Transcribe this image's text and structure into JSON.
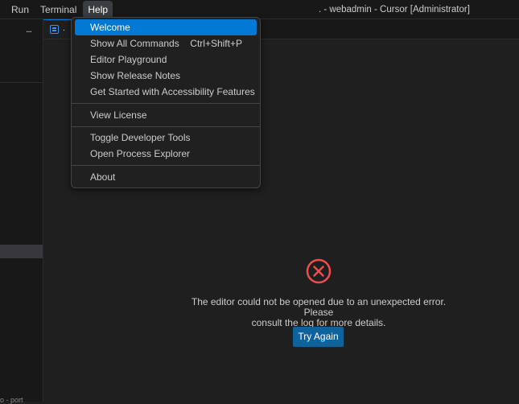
{
  "menubar": {
    "items": [
      "Run",
      "Terminal",
      "Help"
    ],
    "active": "Help"
  },
  "window_title": ". - webadmin - Cursor [Administrator]",
  "sidebar": {
    "more_label": "...",
    "status_text": "o - port"
  },
  "tab": {
    "label": "."
  },
  "help_menu": {
    "items": [
      {
        "label": "Welcome",
        "shortcut": ""
      },
      {
        "label": "Show All Commands",
        "shortcut": "Ctrl+Shift+P"
      },
      {
        "label": "Editor Playground",
        "shortcut": ""
      },
      {
        "label": "Show Release Notes",
        "shortcut": ""
      },
      {
        "label": "Get Started with Accessibility Features",
        "shortcut": ""
      },
      {
        "label": "View License",
        "shortcut": ""
      },
      {
        "label": "Toggle Developer Tools",
        "shortcut": ""
      },
      {
        "label": "Open Process Explorer",
        "shortcut": ""
      },
      {
        "label": "About",
        "shortcut": ""
      }
    ]
  },
  "editor": {
    "error_message_line1": "The editor could not be opened due to an unexpected error. Please",
    "error_message_line2": "consult the log for more details.",
    "try_again_label": "Try Again",
    "error_icon": "error-circle-x-icon"
  },
  "colors": {
    "accent": "#0078d4",
    "button": "#0e639c",
    "error": "#f14c4c",
    "background": "#1f1f1f"
  }
}
